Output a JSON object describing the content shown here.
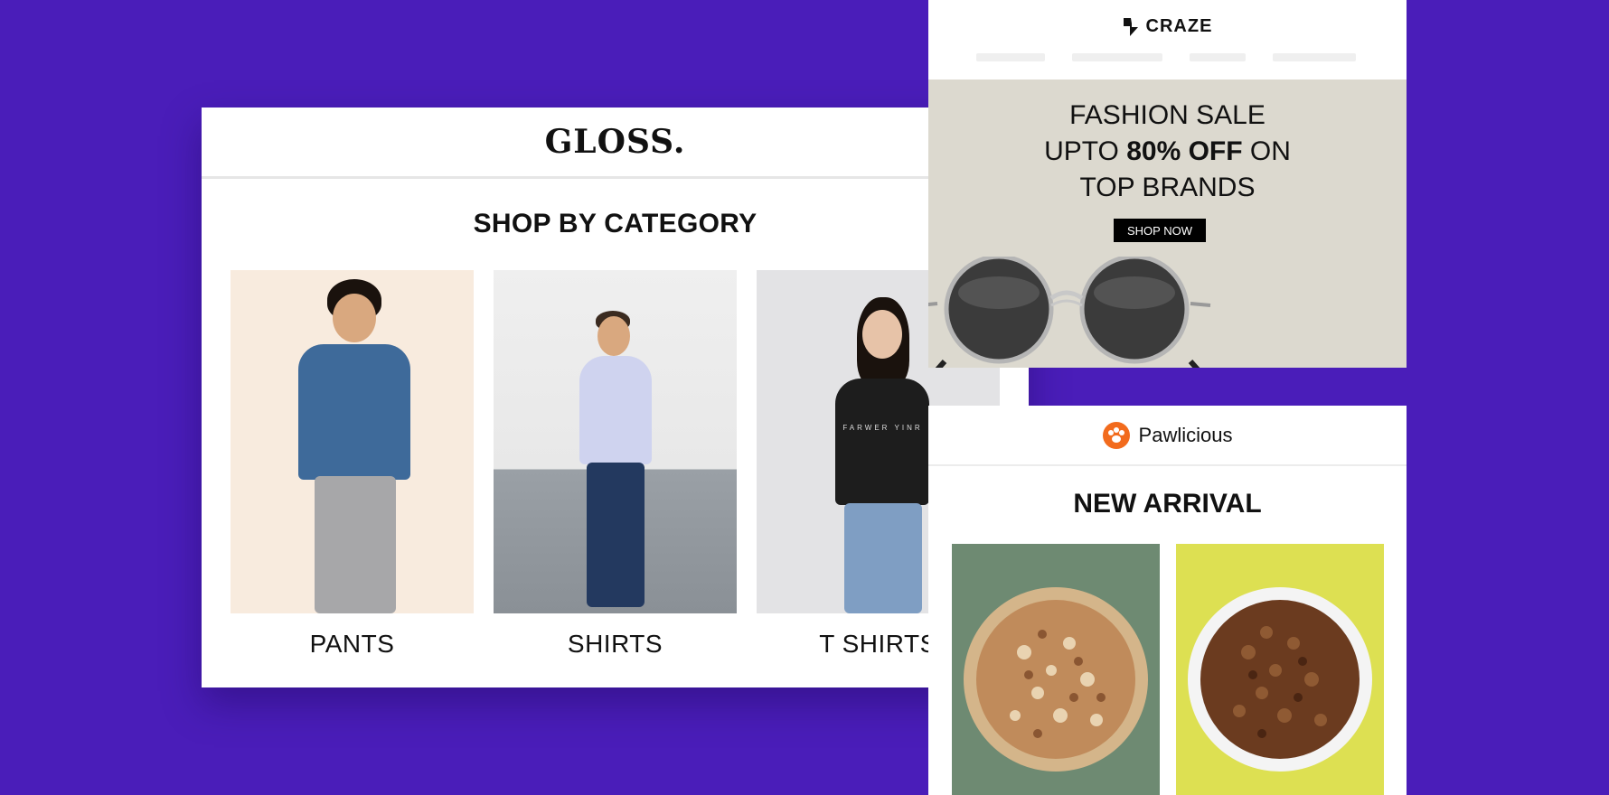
{
  "gloss": {
    "logo": "GLOSS.",
    "heading": "SHOP BY CATEGORY",
    "categories": [
      {
        "label": "PANTS"
      },
      {
        "label": "SHIRTS"
      },
      {
        "label": "T SHIRTS"
      }
    ],
    "tshirt_print": "FARWER YINR"
  },
  "craze": {
    "brand": "CRAZE",
    "headline_line1": "FASHION SALE",
    "headline_line2_pre": "UPTO ",
    "headline_line2_bold": "80% OFF",
    "headline_line2_post": " ON",
    "headline_line3": "TOP BRANDS",
    "cta": "SHOP NOW"
  },
  "pawlicious": {
    "brand": "Pawlicious",
    "heading": "NEW ARRIVAL"
  },
  "colors": {
    "background": "#4a1db9",
    "craze_hero": "#dcd9cf",
    "paw_logo": "#f26b1d",
    "paw_product1_bg": "#6e8a72",
    "paw_product2_bg": "#dde052"
  }
}
